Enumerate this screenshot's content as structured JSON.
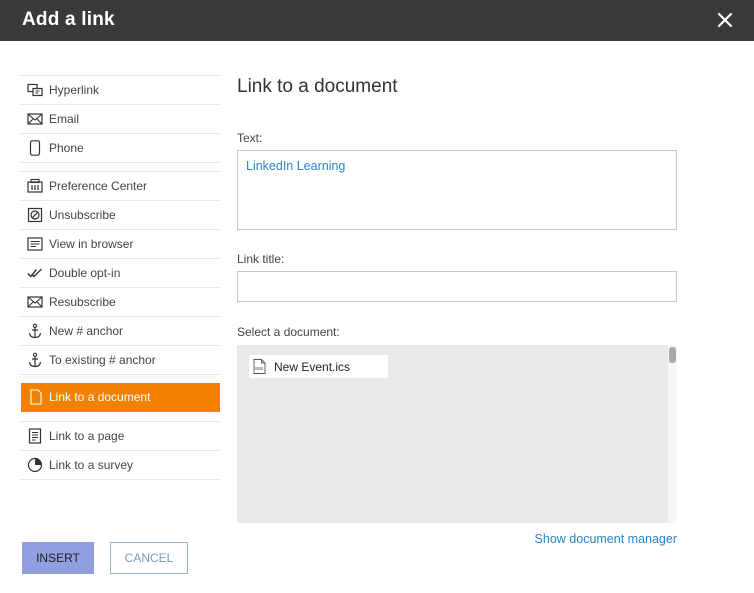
{
  "dialog": {
    "title": "Add a link"
  },
  "sidebar": {
    "group1": [
      {
        "label": "Hyperlink",
        "icon": "hyperlink-icon"
      },
      {
        "label": "Email",
        "icon": "envelope-icon"
      },
      {
        "label": "Phone",
        "icon": "phone-icon"
      }
    ],
    "group2": [
      {
        "label": "Preference Center",
        "icon": "preference-center-icon"
      },
      {
        "label": "Unsubscribe",
        "icon": "unsubscribe-icon"
      },
      {
        "label": "View in browser",
        "icon": "browser-view-icon"
      },
      {
        "label": "Double opt-in",
        "icon": "double-check-icon"
      },
      {
        "label": "Resubscribe",
        "icon": "envelope-icon"
      },
      {
        "label": "New # anchor",
        "icon": "anchor-icon"
      },
      {
        "label": "To existing # anchor",
        "icon": "anchor-icon"
      }
    ],
    "active": {
      "label": "Link to a document",
      "icon": "document-icon"
    },
    "group3": [
      {
        "label": "Link to a page",
        "icon": "page-icon"
      },
      {
        "label": "Link to a survey",
        "icon": "pie-chart-icon"
      }
    ]
  },
  "main": {
    "heading": "Link to a document",
    "text_label": "Text:",
    "text_value": "LinkedIn Learning",
    "title_label": "Link title:",
    "title_value": "",
    "select_label": "Select a document:",
    "documents": [
      {
        "name": "New Event.ics",
        "icon": "file-icon"
      }
    ],
    "manager_link": "Show document manager"
  },
  "buttons": {
    "insert": "INSERT",
    "cancel": "CANCEL"
  },
  "colors": {
    "accent": "#f08200",
    "link": "#2a86c5",
    "insert_bg": "#8f9fe0",
    "header_bg": "#3a3a3a"
  }
}
